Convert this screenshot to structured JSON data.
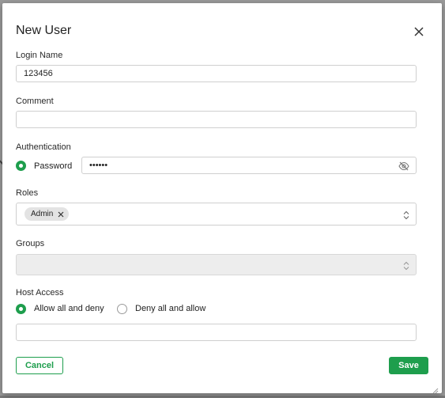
{
  "dialog": {
    "title": "New User",
    "close_icon": "close-icon"
  },
  "login": {
    "label": "Login Name",
    "value": "123456"
  },
  "comment": {
    "label": "Comment",
    "value": ""
  },
  "authentication": {
    "label": "Authentication",
    "method_label": "Password",
    "method_selected": true,
    "password_value": "••••••",
    "toggle_icon": "eye-slash-icon"
  },
  "roles": {
    "label": "Roles",
    "selected": [
      "Admin"
    ],
    "chip_remove_icon": "close-icon",
    "dropdown_icon": "chevron-updown-icon"
  },
  "groups": {
    "label": "Groups",
    "value": "",
    "disabled": true,
    "dropdown_icon": "chevron-updown-icon"
  },
  "host_access": {
    "label": "Host Access",
    "options": [
      {
        "label": "Allow all and deny",
        "selected": true
      },
      {
        "label": "Deny all and allow",
        "selected": false
      }
    ],
    "value": ""
  },
  "footer": {
    "cancel_label": "Cancel",
    "save_label": "Save"
  },
  "colors": {
    "accent": "#1e9e4d",
    "backdrop": "#9a9a9a"
  }
}
